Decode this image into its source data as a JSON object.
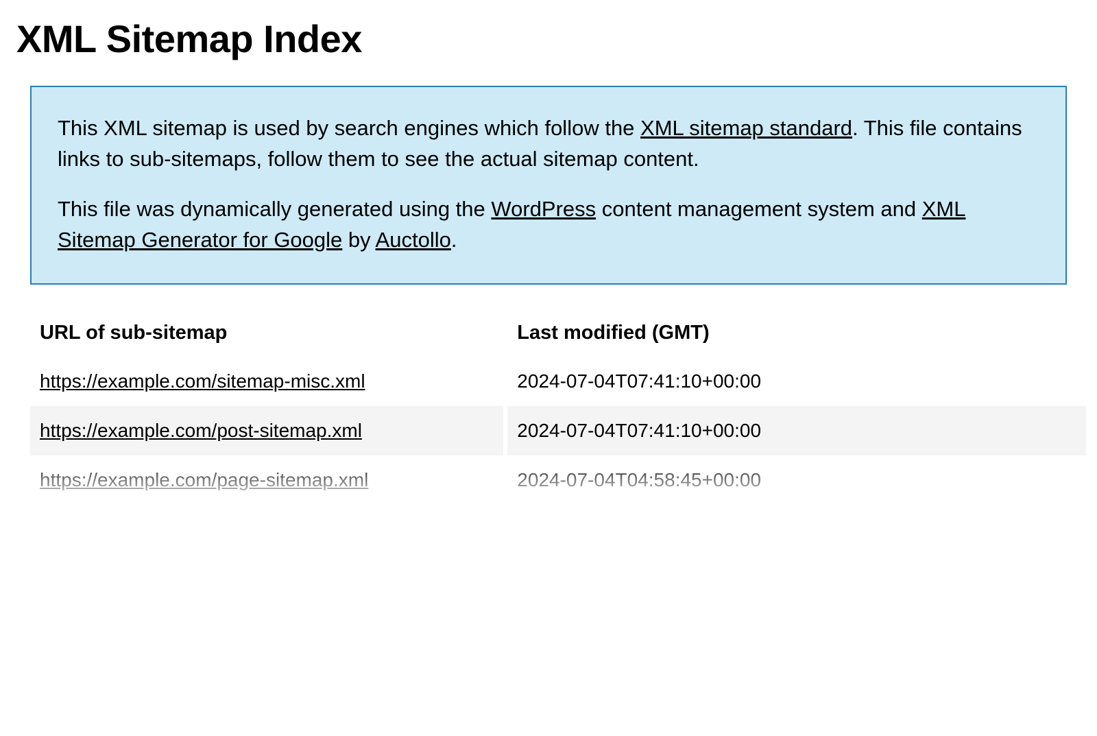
{
  "page": {
    "title": "XML Sitemap Index"
  },
  "intro": {
    "p1_before": "This XML sitemap is used by search engines which follow the ",
    "p1_link": "XML sitemap standard",
    "p1_after": ". This file contains links to sub-sitemaps, follow them to see the actual sitemap content.",
    "p2_before": "This file was dynamically generated using the ",
    "p2_link1": "WordPress",
    "p2_mid": " content management system and ",
    "p2_link2": "XML Sitemap Generator for Google",
    "p2_by": " by ",
    "p2_link3": "Auctollo",
    "p2_end": "."
  },
  "table": {
    "headers": {
      "url": "URL of sub-sitemap",
      "modified": "Last modified (GMT)"
    },
    "rows": [
      {
        "url": "https://example.com/sitemap-misc.xml",
        "modified": "2024-07-04T07:41:10+00:00"
      },
      {
        "url": "https://example.com/post-sitemap.xml",
        "modified": "2024-07-04T07:41:10+00:00"
      },
      {
        "url": "https://example.com/page-sitemap.xml",
        "modified": "2024-07-04T04:58:45+00:00"
      }
    ]
  }
}
